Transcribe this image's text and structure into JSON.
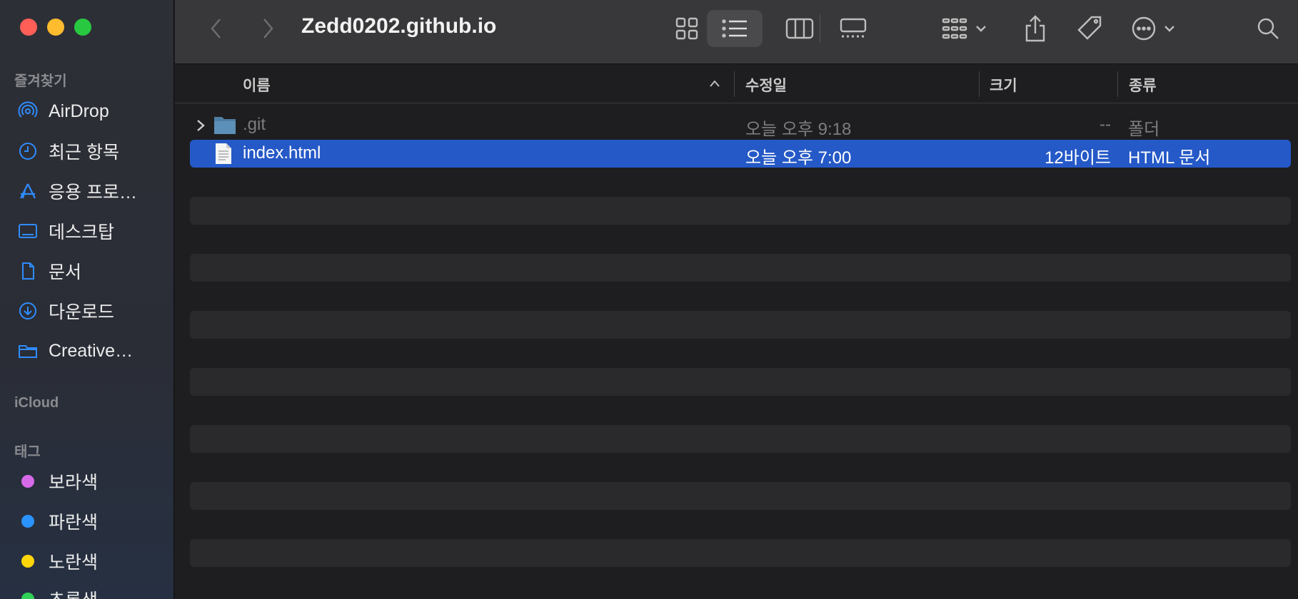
{
  "window": {
    "title": "Zedd0202.github.io"
  },
  "sidebar": {
    "favorites_header": "즐겨찾기",
    "favorites": [
      {
        "label": "AirDrop",
        "icon": "airdrop-icon"
      },
      {
        "label": "최근 항목",
        "icon": "clock-icon"
      },
      {
        "label": "응용 프로…",
        "icon": "applications-icon"
      },
      {
        "label": "데스크탑",
        "icon": "desktop-icon"
      },
      {
        "label": "문서",
        "icon": "document-icon"
      },
      {
        "label": "다운로드",
        "icon": "download-icon"
      },
      {
        "label": "Creative…",
        "icon": "folder-icon"
      }
    ],
    "icloud_header": "iCloud",
    "tags_header": "태그",
    "tags": [
      {
        "label": "보라색",
        "color": "#d76ae8"
      },
      {
        "label": "파란색",
        "color": "#2b93ff"
      },
      {
        "label": "노란색",
        "color": "#ffd60a"
      },
      {
        "label": "초록색",
        "color": "#30d158"
      }
    ]
  },
  "columns": {
    "name": "이름",
    "modified": "수정일",
    "size": "크기",
    "kind": "종류"
  },
  "files": [
    {
      "name": ".git",
      "modified": "오늘 오후 9:18",
      "size": "--",
      "kind": "폴더",
      "type": "folder",
      "selected": false
    },
    {
      "name": "index.html",
      "modified": "오늘 오후 7:00",
      "size": "12바이트",
      "kind": "HTML 문서",
      "type": "file",
      "selected": true
    }
  ],
  "colors": {
    "selection": "#2559c7",
    "accent": "#2f8cff"
  }
}
